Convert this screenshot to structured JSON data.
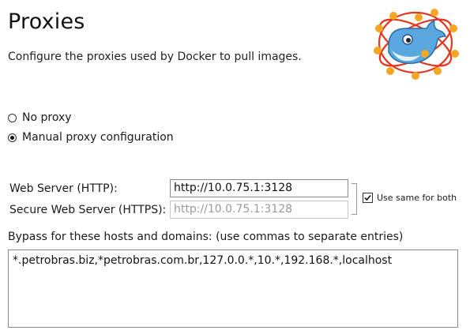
{
  "header": {
    "title": "Proxies",
    "subtitle": "Configure the proxies used by Docker to pull images."
  },
  "logo": {
    "icon": "docker-whale-icon",
    "whale_color": "#5aa7e0",
    "orbit_color": "#e2371f",
    "node_color": "#f5a623"
  },
  "proxy_mode": {
    "options": [
      {
        "label": "No proxy",
        "checked": false
      },
      {
        "label": "Manual proxy configuration",
        "checked": true
      }
    ]
  },
  "web_server": {
    "label": "Web Server (HTTP):",
    "value": "http://10.0.75.1:3128"
  },
  "secure_web_server": {
    "label": "Secure Web Server (HTTPS):",
    "value": "http://10.0.75.1:3128",
    "disabled": true
  },
  "use_same": {
    "label": "Use same for both",
    "checked": true
  },
  "bypass": {
    "label": "Bypass for these hosts and domains: (use commas to separate entries)",
    "value": "*.petrobras.biz,*petrobras.com.br,127.0.0.*,10.*,192.168.*,localhost"
  }
}
